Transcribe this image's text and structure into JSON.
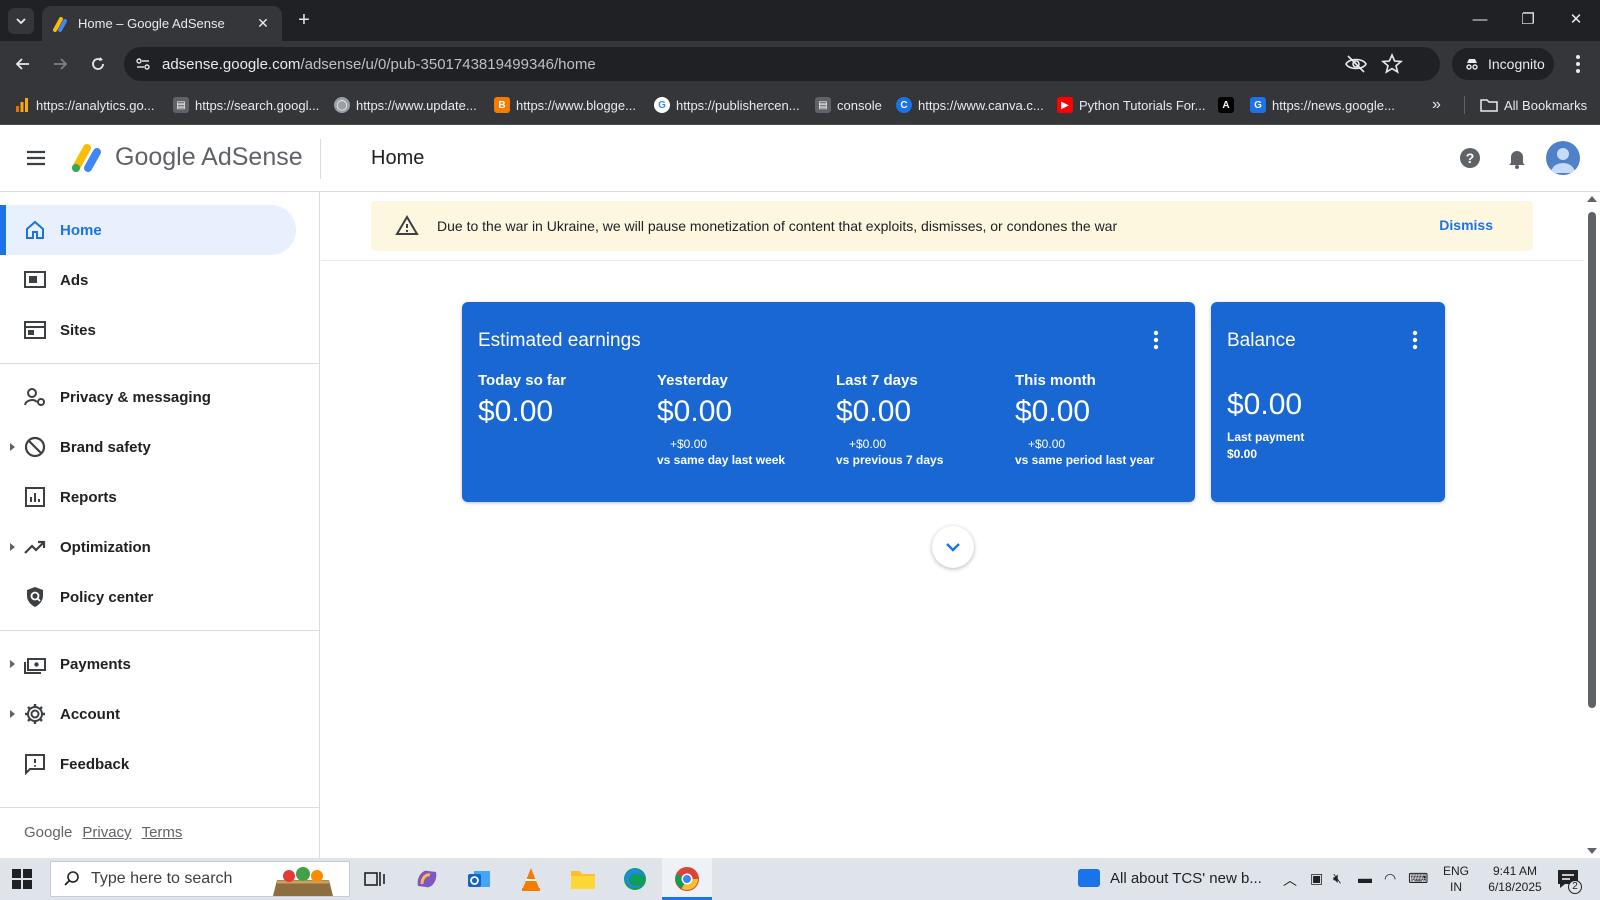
{
  "browser": {
    "tab_title": "Home – Google AdSense",
    "url_host": "adsense.google.com",
    "url_path": "/adsense/u/0/pub-3501743819499346/home",
    "incognito_label": "Incognito",
    "bookmarks": [
      {
        "label": "https://analytics.go...",
        "icon": "analytics-icon",
        "color": "#f9ab00"
      },
      {
        "label": "https://search.googl...",
        "icon": "search-console-icon",
        "color": "#5f6368"
      },
      {
        "label": "https://www.update...",
        "icon": "globe-icon",
        "color": "#9aa0a6"
      },
      {
        "label": "https://www.blogge...",
        "icon": "blogger-icon",
        "color": "#f57c00"
      },
      {
        "label": "https://publishercen...",
        "icon": "google-icon",
        "color": "#ffffff"
      },
      {
        "label": "console",
        "icon": "console-icon",
        "color": "#5f6368"
      },
      {
        "label": "https://www.canva.c...",
        "icon": "canva-icon",
        "color": "#1a73e8"
      },
      {
        "label": "Python Tutorials For...",
        "icon": "youtube-icon",
        "color": "#ff0000"
      },
      {
        "label": "",
        "icon": "a-letter-icon",
        "color": "#000000"
      },
      {
        "label": "https://news.google...",
        "icon": "google-news-icon",
        "color": "#1a73e8"
      }
    ],
    "all_bookmarks_label": "All Bookmarks"
  },
  "header": {
    "product_name": "Google AdSense",
    "page_title": "Home"
  },
  "sidebar": {
    "items": [
      {
        "label": "Home",
        "icon": "home-icon",
        "active": true,
        "expandable": false
      },
      {
        "label": "Ads",
        "icon": "ads-icon",
        "active": false,
        "expandable": false
      },
      {
        "label": "Sites",
        "icon": "sites-icon",
        "active": false,
        "expandable": false
      },
      {
        "label": "Privacy & messaging",
        "icon": "privacy-icon",
        "active": false,
        "expandable": false
      },
      {
        "label": "Brand safety",
        "icon": "block-icon",
        "active": false,
        "expandable": true
      },
      {
        "label": "Reports",
        "icon": "reports-icon",
        "active": false,
        "expandable": false
      },
      {
        "label": "Optimization",
        "icon": "trending-icon",
        "active": false,
        "expandable": true
      },
      {
        "label": "Policy center",
        "icon": "policy-icon",
        "active": false,
        "expandable": false
      },
      {
        "label": "Payments",
        "icon": "payments-icon",
        "active": false,
        "expandable": true
      },
      {
        "label": "Account",
        "icon": "settings-icon",
        "active": false,
        "expandable": true
      },
      {
        "label": "Feedback",
        "icon": "feedback-icon",
        "active": false,
        "expandable": false
      }
    ],
    "footer": {
      "brand": "Google",
      "privacy": "Privacy",
      "terms": "Terms"
    }
  },
  "banner": {
    "text": "Due to the war in Ukraine, we will pause monetization of content that exploits, dismisses, or condones the war",
    "dismiss": "Dismiss"
  },
  "earnings": {
    "title": "Estimated earnings",
    "metrics": [
      {
        "label": "Today so far",
        "value": "$0.00",
        "delta": "",
        "compare": ""
      },
      {
        "label": "Yesterday",
        "value": "$0.00",
        "delta": "+$0.00",
        "compare": "vs same day last week"
      },
      {
        "label": "Last 7 days",
        "value": "$0.00",
        "delta": "+$0.00",
        "compare": "vs previous 7 days"
      },
      {
        "label": "This month",
        "value": "$0.00",
        "delta": "+$0.00",
        "compare": "vs same period last year"
      }
    ]
  },
  "balance": {
    "title": "Balance",
    "value": "$0.00",
    "last_payment_label": "Last payment",
    "last_payment_value": "$0.00"
  },
  "taskbar": {
    "search_placeholder": "Type here to search",
    "news": "All about TCS' new b...",
    "lang_line1": "ENG",
    "lang_line2": "IN",
    "time": "9:41 AM",
    "date": "6/18/2025",
    "notification_count": "2"
  },
  "colors": {
    "card_blue": "#1967d2",
    "accent": "#1a73e8",
    "banner_bg": "#fef7e0"
  }
}
